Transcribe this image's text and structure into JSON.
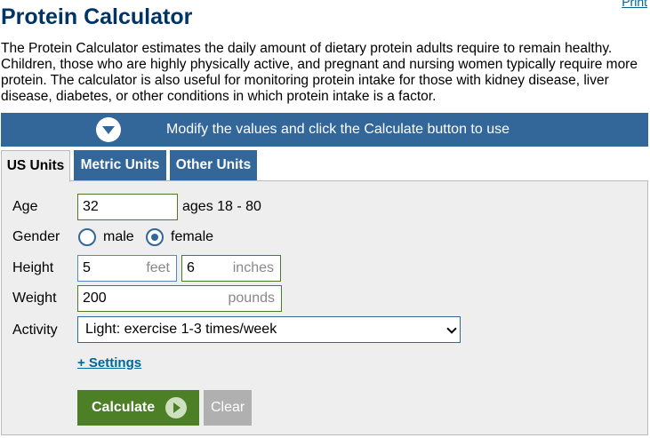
{
  "header": {
    "print_label": "Print",
    "title": "Protein Calculator",
    "intro": "The Protein Calculator estimates the daily amount of dietary protein adults require to remain healthy. Children, those who are highly physically active, and pregnant and nursing women typically require more protein. The calculator is also useful for monitoring protein intake for those with kidney disease, liver disease, diabetes, or other conditions in which protein intake is a factor."
  },
  "banner": {
    "icon": "chevron-down-circle-icon",
    "text": "Modify the values and click the Calculate button to use"
  },
  "tabs": [
    {
      "label": "US Units",
      "active": true
    },
    {
      "label": "Metric Units",
      "active": false
    },
    {
      "label": "Other Units",
      "active": false
    }
  ],
  "form": {
    "age": {
      "label": "Age",
      "value": "32",
      "hint": "ages 18 - 80"
    },
    "gender": {
      "label": "Gender",
      "options": [
        "male",
        "female"
      ],
      "selected": "female"
    },
    "height": {
      "label": "Height",
      "feet_value": "5",
      "feet_unit": "feet",
      "inches_value": "6",
      "inches_unit": "inches"
    },
    "weight": {
      "label": "Weight",
      "value": "200",
      "unit": "pounds"
    },
    "activity": {
      "label": "Activity",
      "selected": "Light: exercise 1-3 times/week"
    },
    "settings_link": "+ Settings"
  },
  "buttons": {
    "calculate": "Calculate",
    "clear": "Clear"
  },
  "colors": {
    "title": "#003366",
    "banner": "#336699",
    "calculate": "#4c7f26",
    "clear": "#b0b0b0",
    "link": "#006699"
  }
}
